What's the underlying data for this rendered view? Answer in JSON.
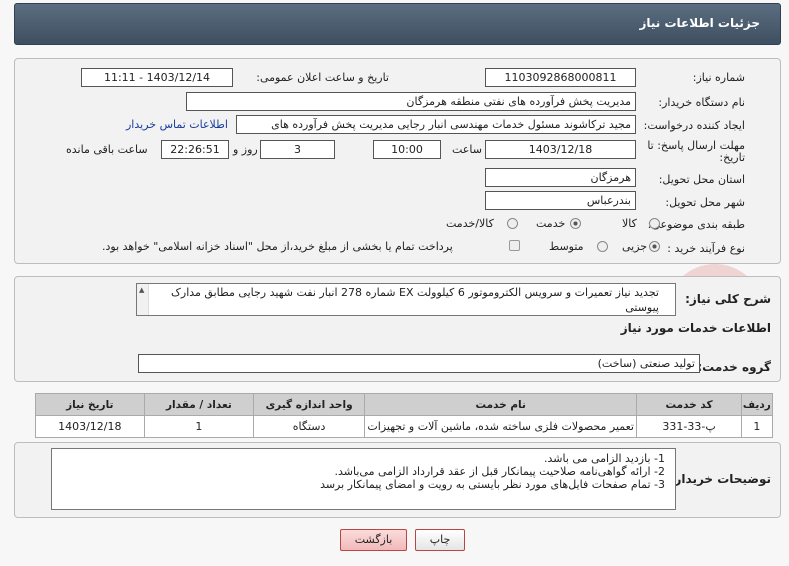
{
  "header": {
    "title": "جزئیات اطلاعات نیاز"
  },
  "form": {
    "need_number_label": "شماره نیاز:",
    "need_number": "1103092868000811",
    "announce_label": "تاریخ و ساعت اعلان عمومی:",
    "announce_value": "1403/12/14 - 11:11",
    "buyer_org_label": "نام دستگاه خریدار:",
    "buyer_org": "مدیریت پخش فرآورده های نفتی منطقه هرمزگان",
    "requester_label": "ایجاد کننده درخواست:",
    "requester": "مجید ترکاشوند مسئول خدمات مهندسی انبار رجایی مدیریت پخش فرآورده های",
    "contact_link": "اطلاعات تماس خریدار",
    "deadline_label_1": "مهلت ارسال پاسخ: تا",
    "deadline_label_2": "تاریخ:",
    "deadline_date": "1403/12/18",
    "time_label": "ساعت",
    "deadline_time": "10:00",
    "days_value": "3",
    "days_label": "روز و",
    "remaining_time": "22:26:51",
    "remaining_label": "ساعت باقی مانده",
    "province_label": "استان محل تحویل:",
    "province": "هرمزگان",
    "city_label": "شهر محل تحویل:",
    "city": "بندرعباس",
    "category_label": "طبقه بندی موضوعی:",
    "category_options": [
      "کالا",
      "خدمت",
      "کالا/خدمت"
    ],
    "process_label": "نوع فرآیند خرید :",
    "process_options": [
      "جزیی",
      "متوسط"
    ],
    "payment_note": "پرداخت تمام یا بخشی از مبلغ خرید،از محل \"اسناد خزانه اسلامی\" خواهد بود."
  },
  "summary": {
    "label": "شرح کلی نیاز:",
    "text_line1": "تجدید نیاز تعمیرات و سرویس الکتروموتور 6 کیلوولت EX شماره 278 انبار نفت شهید رجایی مطابق مدارک",
    "text_line2": "پیوستی"
  },
  "services": {
    "section_title": "اطلاعات خدمات مورد نیاز",
    "group_label": "گروه خدمت:",
    "group_value": "تولید صنعتی (ساخت)",
    "columns": [
      "ردیف",
      "کد خدمت",
      "نام خدمت",
      "واحد اندازه گیری",
      "تعداد / مقدار",
      "تاریخ نیاز"
    ],
    "rows": [
      [
        "1",
        "پ-33-331",
        "تعمیر محصولات فلزی ساخته شده، ماشین آلات و تجهیزات",
        "دستگاه",
        "1",
        "1403/12/18"
      ]
    ]
  },
  "buyer_notes": {
    "label": "توضیحات خریدار:",
    "lines": [
      "1-    بازدید الزامی می باشد.",
      "2-    ارائه گواهی‌نامه صلاحیت پیمانکار قبل از عقد قرارداد الزامی می‌باشد.",
      "3-    تمام صفحات فایل‌های مورد نظر بایستی به رویت و امضای پیمانکار برسد"
    ]
  },
  "buttons": {
    "print": "چاپ",
    "back": "بازگشت"
  }
}
